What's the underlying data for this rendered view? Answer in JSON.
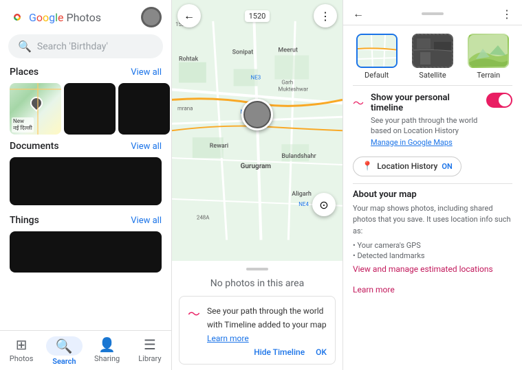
{
  "app": {
    "title": "Google Photos",
    "logo_letters": [
      "G",
      "o",
      "o",
      "g",
      "l",
      "e"
    ],
    "logo_colors": [
      "#4285F4",
      "#EA4335",
      "#FBBC05",
      "#4285F4",
      "#34A853",
      "#EA4335"
    ]
  },
  "search": {
    "placeholder": "Search 'Birthday'"
  },
  "sections": {
    "places": {
      "title": "Places",
      "view_all": "View all",
      "items": [
        {
          "label": "New Delhi",
          "sub": "नई दिल्ली"
        },
        {
          "label": ""
        },
        {
          "label": ""
        }
      ]
    },
    "documents": {
      "title": "Documents",
      "view_all": "View all"
    },
    "things": {
      "title": "Things",
      "view_all": "View all"
    }
  },
  "bottom_nav": {
    "items": [
      {
        "label": "Photos",
        "icon": "▦",
        "active": false
      },
      {
        "label": "Search",
        "icon": "⌕",
        "active": true
      },
      {
        "label": "Sharing",
        "icon": "👤",
        "active": false
      },
      {
        "label": "Library",
        "icon": "▥",
        "active": false
      }
    ]
  },
  "map_panel": {
    "back_icon": "←",
    "menu_icon": "⋮",
    "label": "1520",
    "no_photos_text": "No photos in this area",
    "timeline_card": {
      "title": "See your path through the world with Timeline added to your map",
      "learn_more": "Learn more",
      "hide": "Hide Timeline",
      "ok": "OK"
    },
    "location_btn": "⊙"
  },
  "right_panel": {
    "back_icon": "←",
    "menu_icon": "⋮",
    "map_types": [
      {
        "label": "Default",
        "selected": true
      },
      {
        "label": "Satellite",
        "selected": false
      },
      {
        "label": "Terrain",
        "selected": false
      }
    ],
    "personal_timeline": {
      "title": "Show your personal timeline",
      "description": "See your path through the world based on Location History",
      "manage_link": "Manage in Google Maps",
      "toggle_on": true
    },
    "location_history_btn": {
      "prefix": "Location History",
      "badge": "ON"
    },
    "about_map": {
      "title": "About your map",
      "description": "Your map shows photos, including shared photos that you save. It uses location info such as:",
      "items": [
        "Your camera's GPS",
        "Detected landmarks"
      ],
      "view_link": "View and manage estimated locations",
      "learn_more": "Learn more"
    }
  }
}
